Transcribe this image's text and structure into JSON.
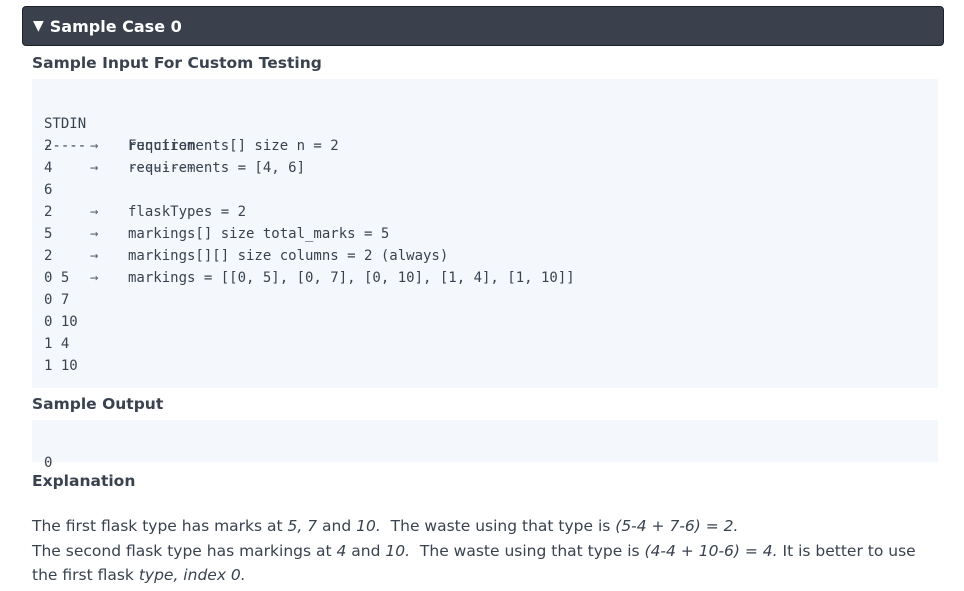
{
  "sample_case": {
    "toggle_icon": "caret-down-icon",
    "caret": "▼",
    "title": "Sample Case 0"
  },
  "input_section": {
    "heading": "Sample Input For Custom Testing",
    "col_stdin": "STDIN",
    "col_function": "Function",
    "sep_stdin": "-----",
    "sep_function": "--------",
    "rows": [
      {
        "stdin": "2",
        "arrow": "→",
        "func": "requirements[] size n = 2"
      },
      {
        "stdin": "4",
        "arrow": "→",
        "func": "requirements = [4, 6]"
      },
      {
        "stdin": "6",
        "arrow": "",
        "func": ""
      },
      {
        "stdin": "2",
        "arrow": "→",
        "func": "flaskTypes = 2"
      },
      {
        "stdin": "5",
        "arrow": "→",
        "func": "markings[] size total_marks = 5"
      },
      {
        "stdin": "2",
        "arrow": "→",
        "func": "markings[][] size columns = 2 (always)"
      },
      {
        "stdin": "0 5",
        "arrow": "→",
        "func": "markings = [[0, 5], [0, 7], [0, 10], [1, 4], [1, 10]]"
      },
      {
        "stdin": "0 7",
        "arrow": "",
        "func": ""
      },
      {
        "stdin": "0 10",
        "arrow": "",
        "func": ""
      },
      {
        "stdin": "1 4",
        "arrow": "",
        "func": ""
      },
      {
        "stdin": "1 10",
        "arrow": "",
        "func": ""
      }
    ]
  },
  "output_section": {
    "heading": "Sample Output",
    "value": "0"
  },
  "explanation": {
    "heading": "Explanation",
    "p1": {
      "t1": "The first flask type has marks at ",
      "e1": "5, 7",
      "t2": " and ",
      "e2": "10.",
      "t3": "  The waste using that type is ",
      "e3": "(5-4 + 7-6) = 2."
    },
    "p2": {
      "t1": "The second flask type has markings at ",
      "e1": "4",
      "t2": " and ",
      "e2": "10.",
      "t3": "  The waste using that type is ",
      "e3": "(4-4 + 10-6) = 4.",
      "t4": " It is better to use the first flask ",
      "e4": "type, index 0."
    }
  }
}
